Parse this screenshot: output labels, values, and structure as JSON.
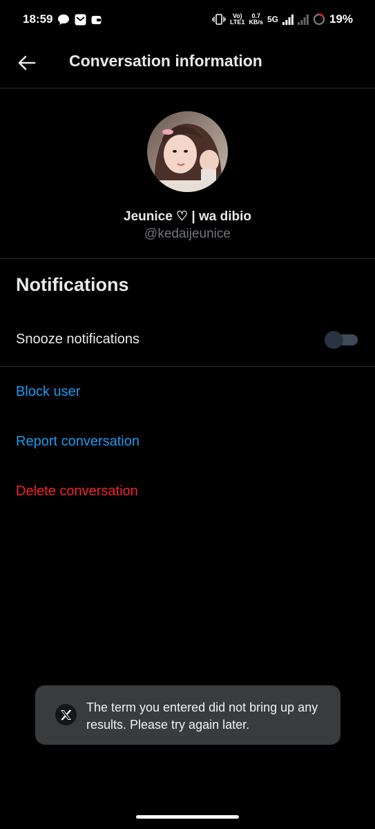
{
  "status_bar": {
    "time": "18:59",
    "network_speed_value": "0.7",
    "network_speed_unit": "KB/s",
    "volte_label": "Vo)",
    "lte_label": "LTE1",
    "network_type": "5G",
    "battery_percent": "19%"
  },
  "header": {
    "title": "Conversation information",
    "back_icon": "arrow-left-icon"
  },
  "profile": {
    "display_name": "Jeunice ♡ | wa dibio",
    "handle": "@kedaijeunice"
  },
  "notifications": {
    "title": "Notifications",
    "snooze_label": "Snooze notifications",
    "snooze_on": false
  },
  "actions": {
    "block": "Block user",
    "report": "Report conversation",
    "delete": "Delete conversation"
  },
  "toast": {
    "icon": "x-logo-icon",
    "message": "The term you entered did not bring up any results. Please try again later."
  },
  "colors": {
    "background": "#000000",
    "link_blue": "#1d9bf0",
    "danger_red": "#f4212e",
    "muted_text": "#71767b",
    "toast_bg": "#3a3b3c"
  }
}
